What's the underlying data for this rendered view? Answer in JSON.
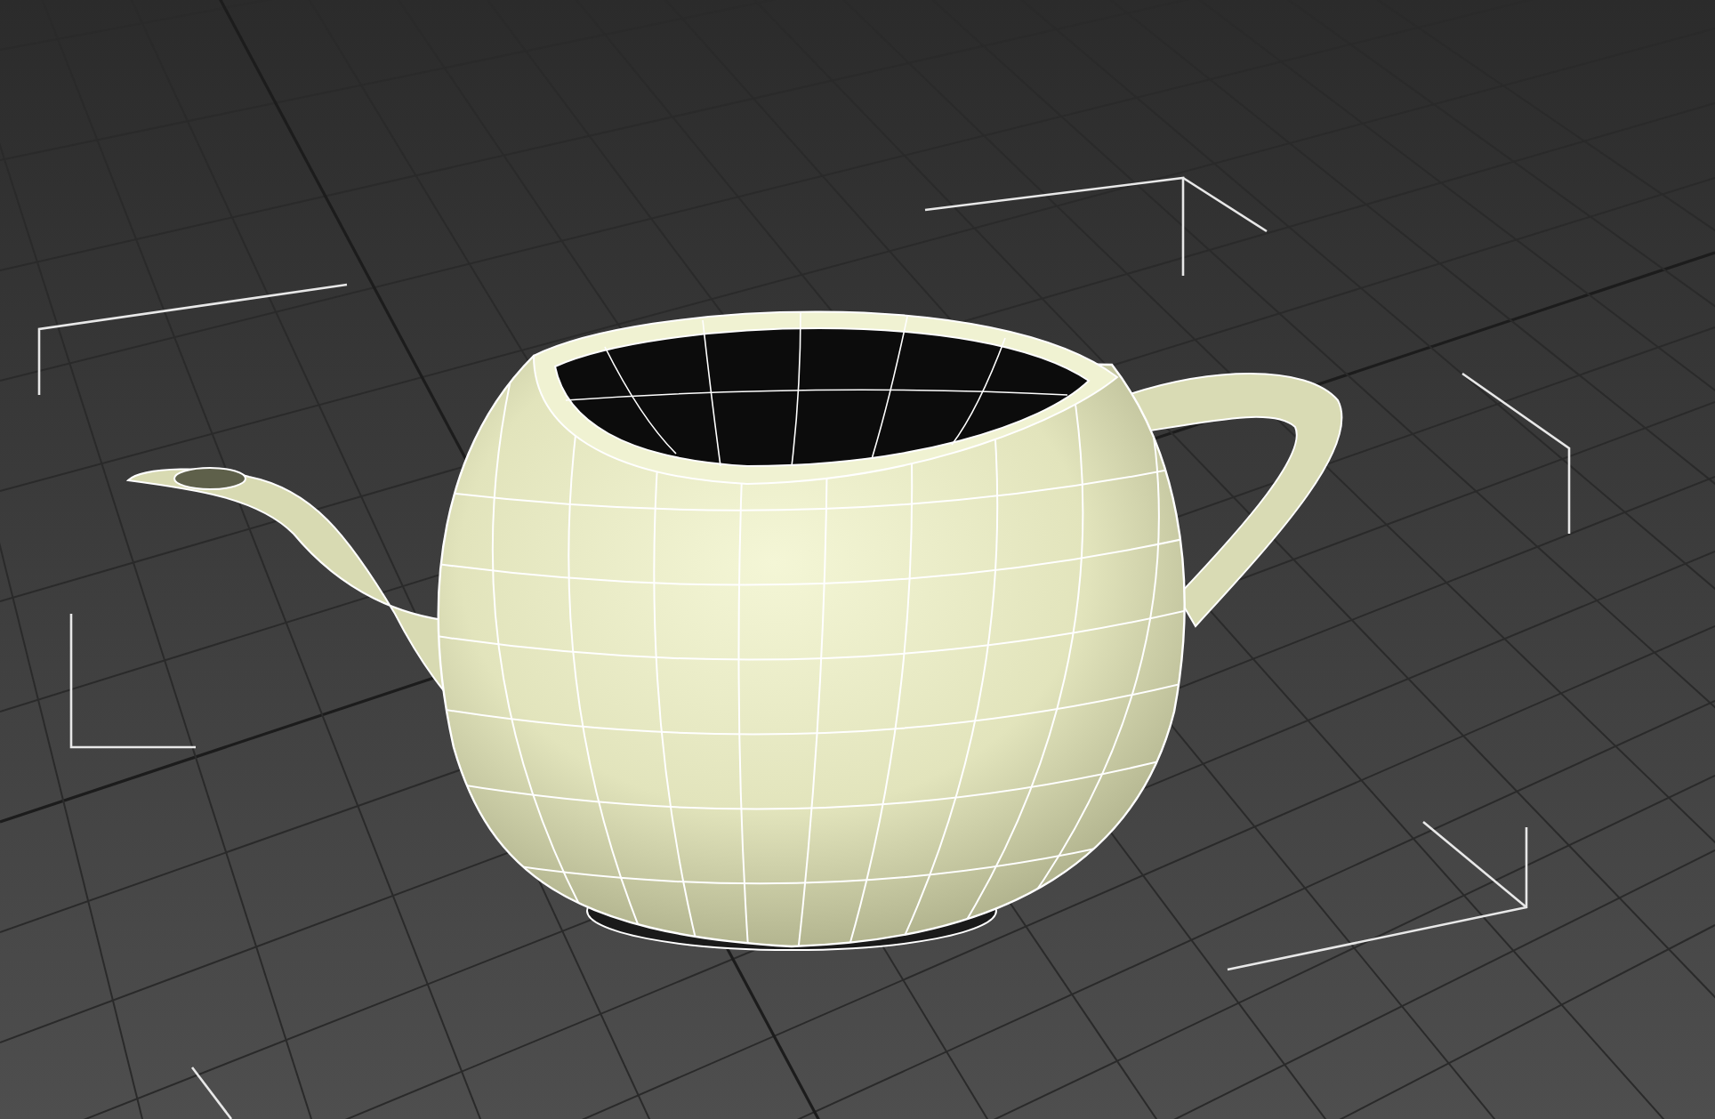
{
  "viewport": {
    "show_grid": true,
    "selected": true
  }
}
